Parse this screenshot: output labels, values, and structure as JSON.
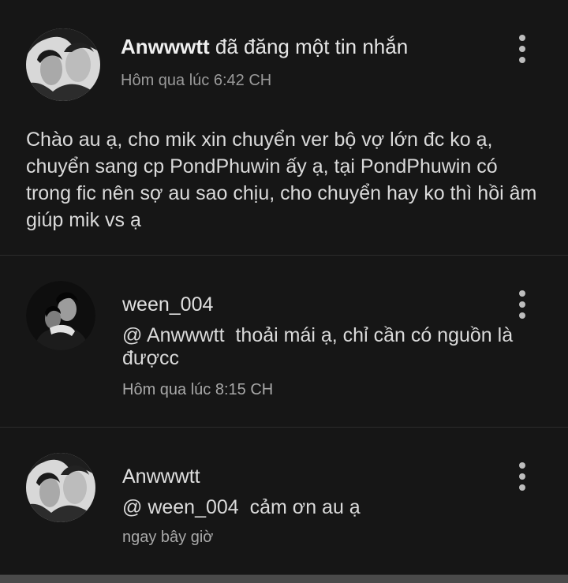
{
  "post": {
    "author": "Anwwwtt",
    "action": "đã đăng một tin nhắn",
    "time": "Hôm qua lúc 6:42 CH",
    "body": "Chào au ạ, cho mik xin chuyển ver bộ vợ lớn đc ko ạ, chuyển sang cp PondPhuwin ấy ạ, tại PondPhuwin có trong fic nên sợ au sao chịu, cho chuyển hay ko thì hồi âm giúp mik vs ạ"
  },
  "replies": [
    {
      "author": "ween_004",
      "mention": "@ Anwwwtt",
      "text": "thoải mái ạ, chỉ cần có nguồn là đượcc",
      "time": "Hôm qua lúc 8:15 CH"
    },
    {
      "author": "Anwwwtt",
      "mention": "@ ween_004",
      "text": "cảm ơn au ạ",
      "time": "ngay bây giờ"
    }
  ],
  "icons": {
    "more": "more-vertical-icon"
  },
  "colors": {
    "background": "#161616",
    "divider": "#2c2c2c",
    "text": "#dadada",
    "muted": "#9a9a9a"
  }
}
